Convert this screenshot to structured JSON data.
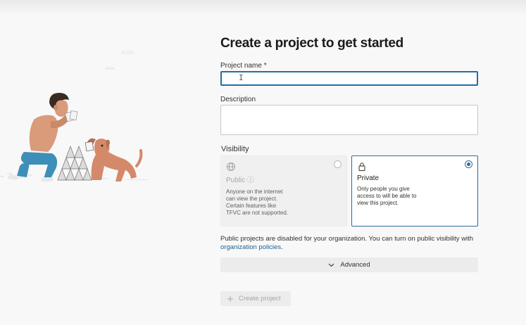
{
  "page": {
    "title": "Create a project to get started"
  },
  "form": {
    "project_name_label": "Project name *",
    "project_name_value": "",
    "description_label": "Description",
    "description_value": "",
    "visibility_label": "Visibility",
    "visibility_selected": "Private"
  },
  "visibility_options": [
    {
      "title": "Public ⓘ",
      "description": "Anyone on the internet\ncan view the project.\nCertain features like\nTFVC are not supported.",
      "icon": "globe-icon",
      "enabled": false
    },
    {
      "title": "Private",
      "description": "Only people you give\naccess to will be able to\nview this project.",
      "icon": "lock-icon",
      "enabled": true
    }
  ],
  "notice": {
    "text": "Public projects are disabled for your organization. You can turn on public visibility with",
    "link_text": "organization policies",
    "suffix": "."
  },
  "advanced": {
    "label": "Advanced",
    "icon": "chevron-down-icon"
  },
  "create_button": {
    "label": "Create project",
    "icon": "plus-icon",
    "enabled": false
  },
  "colors": {
    "accent": "#1f6fa8",
    "link": "#1a5f95",
    "disabled_text": "#a6a6a6"
  }
}
